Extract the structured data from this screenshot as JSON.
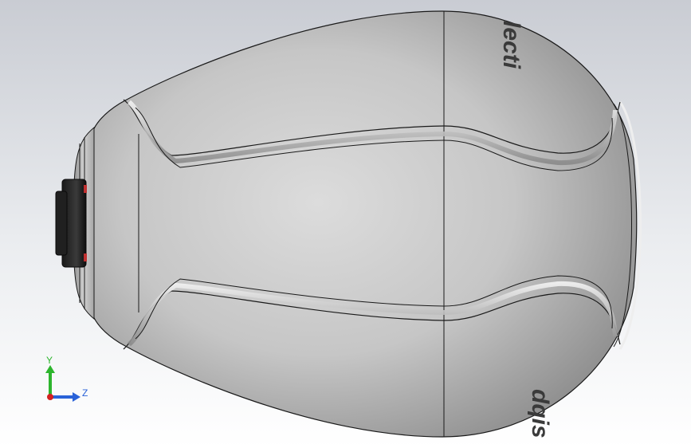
{
  "model": {
    "logo_top": "lecti",
    "logo_bottom": "dqis",
    "body_color": "#c4c4c4",
    "edge_color": "#1a1a1a"
  },
  "triad": {
    "y_label": "Y",
    "z_label": "Z",
    "y_color": "#2db52d",
    "z_color": "#2a62d8",
    "x_color": "#d42020"
  }
}
